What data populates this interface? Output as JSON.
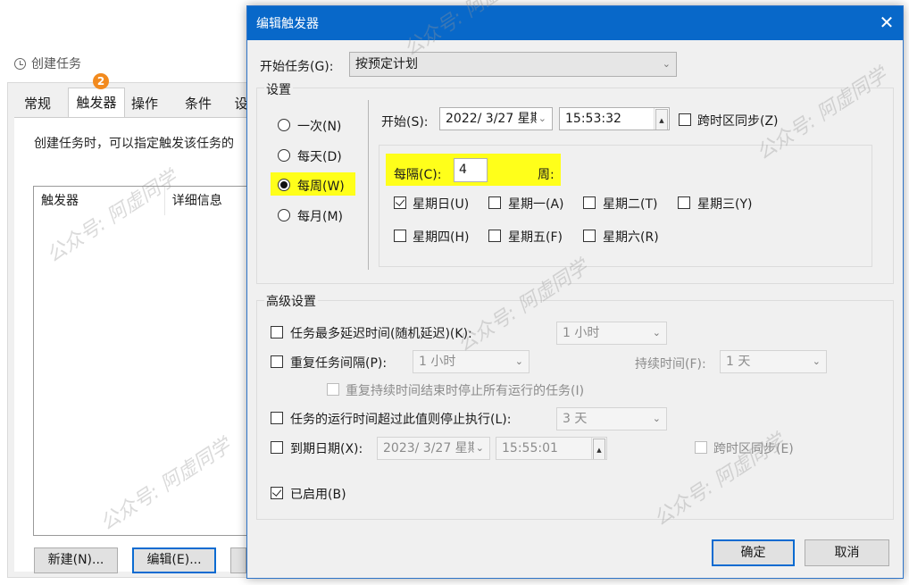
{
  "back": {
    "title": "创建任务",
    "tabs": [
      "常规",
      "触发器",
      "操作",
      "条件",
      "设"
    ],
    "badge": "2",
    "desc": "创建任务时，可以指定触发该任务的",
    "columns": [
      "触发器",
      "详细信息"
    ],
    "buttons": {
      "new": "新建(N)...",
      "edit": "编辑(E)..."
    }
  },
  "dialog": {
    "title": "编辑触发器",
    "close_glyph": "✕",
    "start_task_label": "开始任务(G):",
    "start_task_value": "按预定计划",
    "settings_label": "设置",
    "radios": [
      {
        "label": "一次(N)",
        "checked": false
      },
      {
        "label": "每天(D)",
        "checked": false
      },
      {
        "label": "每周(W)",
        "checked": true
      },
      {
        "label": "每月(M)",
        "checked": false
      }
    ],
    "start_label": "开始(S):",
    "start_date": "2022/  3/27 星期",
    "start_time": "15:53:32",
    "sync_tz_label": "跨时区同步(Z)",
    "every_label": "每隔(C):",
    "every_value": "4",
    "week_unit": "周:",
    "days": [
      {
        "label": "星期日(U)",
        "checked": true
      },
      {
        "label": "星期一(A)",
        "checked": false
      },
      {
        "label": "星期二(T)",
        "checked": false
      },
      {
        "label": "星期三(Y)",
        "checked": false
      },
      {
        "label": "星期四(H)",
        "checked": false
      },
      {
        "label": "星期五(F)",
        "checked": false
      },
      {
        "label": "星期六(R)",
        "checked": false
      }
    ],
    "advanced_label": "高级设置",
    "delay_label": "任务最多延迟时间(随机延迟)(K):",
    "delay_value": "1 小时",
    "repeat_label": "重复任务间隔(P):",
    "repeat_value": "1 小时",
    "duration_label": "持续时间(F):",
    "duration_value": "1 天",
    "stop_all_label": "重复持续时间结束时停止所有运行的任务(I)",
    "stop_longer_label": "任务的运行时间超过此值则停止执行(L):",
    "stop_longer_value": "3 天",
    "expire_label": "到期日期(X):",
    "expire_date": "2023/  3/27 星期",
    "expire_time": "15:55:01",
    "expire_sync_label": "跨时区同步(E)",
    "enabled_label": "已启用(B)",
    "ok": "确定",
    "cancel": "取消"
  },
  "watermark": "公众号: 阿虚同学",
  "colors": {
    "title_bar": "#0868c9",
    "highlight": "#ffff1a",
    "badge": "#f28a1e"
  }
}
